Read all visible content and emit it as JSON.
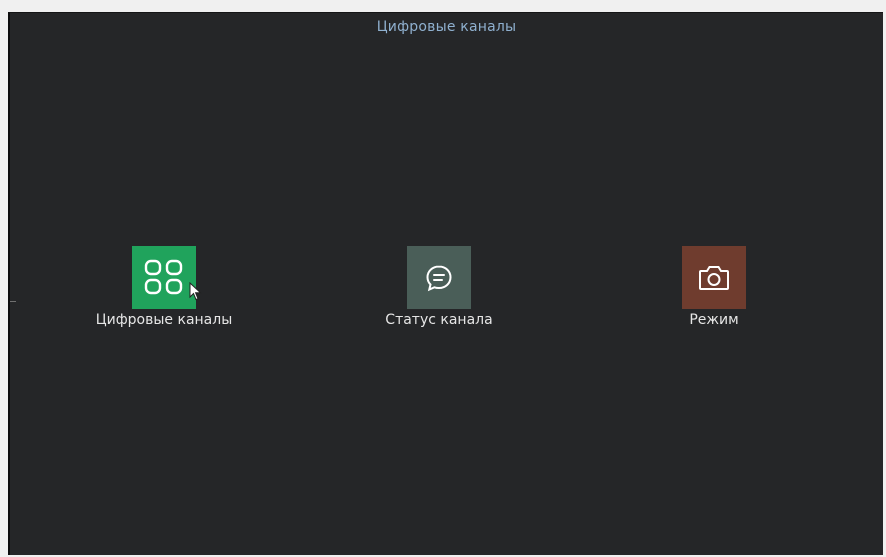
{
  "window": {
    "title": "Цифровые каналы"
  },
  "menu": {
    "items": [
      {
        "label": "Цифровые каналы",
        "icon": "grid-icon",
        "color": "#20a35c"
      },
      {
        "label": "Статус канала",
        "icon": "chat-bubble-icon",
        "color": "#4a5e58"
      },
      {
        "label": "Режим",
        "icon": "camera-icon",
        "color": "#6f3c2e"
      }
    ]
  },
  "colors": {
    "background": "#252628",
    "title": "#8fb0cf",
    "label": "#e6e6e6"
  }
}
